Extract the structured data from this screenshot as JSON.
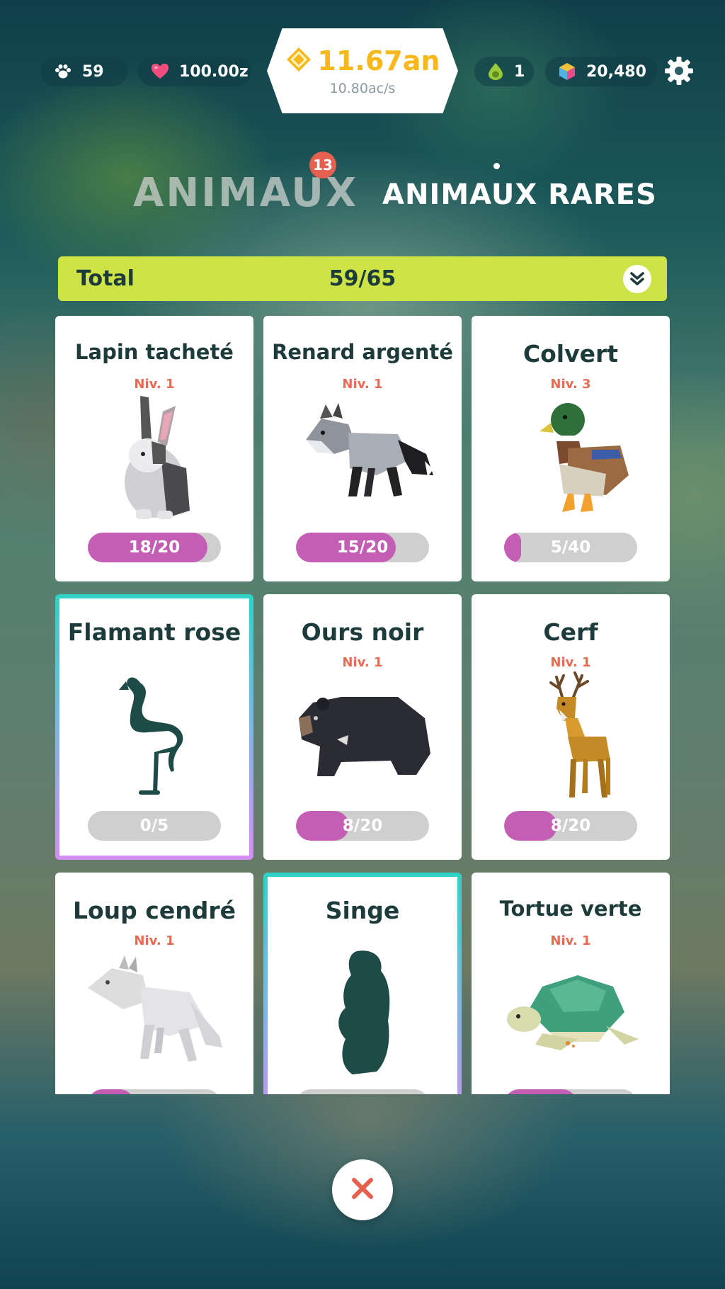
{
  "hud": {
    "paw_count": "59",
    "hearts": "100.00z",
    "coins": "11.67an",
    "coin_rate": "10.80ac/s",
    "seeds": "1",
    "gems": "20,480"
  },
  "tabs": {
    "animaux": "ANIMAUX",
    "animaux_badge": "13",
    "animaux_rares": "ANIMAUX RARES"
  },
  "total": {
    "label": "Total",
    "value": "59/65"
  },
  "cards": [
    {
      "name": "Lapin tacheté",
      "level": "Niv. 1",
      "progress_text": "18/20",
      "progress": 0.9,
      "locked": false,
      "art": "rabbit"
    },
    {
      "name": "Renard argenté",
      "level": "Niv. 1",
      "progress_text": "15/20",
      "progress": 0.75,
      "locked": false,
      "art": "fox"
    },
    {
      "name": "Colvert",
      "level": "Niv. 3",
      "progress_text": "5/40",
      "progress": 0.125,
      "locked": false,
      "art": "duck"
    },
    {
      "name": "Flamant rose",
      "level": "",
      "progress_text": "0/5",
      "progress": 0,
      "locked": true,
      "art": "flamingo"
    },
    {
      "name": "Ours noir",
      "level": "Niv. 1",
      "progress_text": "8/20",
      "progress": 0.4,
      "locked": false,
      "art": "bear"
    },
    {
      "name": "Cerf",
      "level": "Niv. 1",
      "progress_text": "8/20",
      "progress": 0.4,
      "locked": false,
      "art": "deer"
    },
    {
      "name": "Loup cendré",
      "level": "Niv. 1",
      "progress_text": "",
      "progress": 0.35,
      "locked": false,
      "art": "wolf"
    },
    {
      "name": "Singe",
      "level": "",
      "progress_text": "",
      "progress": 0,
      "locked": true,
      "art": "monkey"
    },
    {
      "name": "Tortue verte",
      "level": "Niv. 1",
      "progress_text": "",
      "progress": 0.55,
      "locked": false,
      "art": "turtle"
    }
  ],
  "colors": {
    "coin": "#f6b81b",
    "total_bar": "#cde346",
    "progress_fill": "#c45eb5",
    "level_text": "#e86a53",
    "silhouette": "#1e4a48",
    "close_x": "#e5604e"
  }
}
